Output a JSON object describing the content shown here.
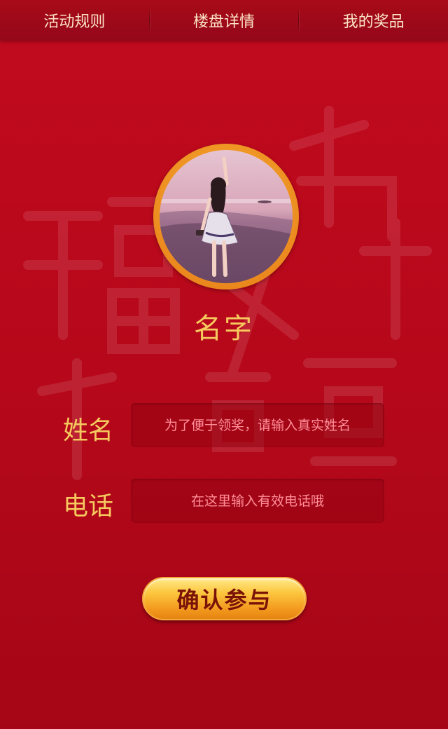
{
  "nav": {
    "items": [
      {
        "label": "活动规则"
      },
      {
        "label": "楼盘详情"
      },
      {
        "label": "我的奖品"
      }
    ]
  },
  "profile": {
    "name": "名字",
    "avatar_icon": "user-photo"
  },
  "form": {
    "name_label": "姓名",
    "name_placeholder": "为了便于领奖，请输入真实姓名",
    "phone_label": "电话",
    "phone_placeholder": "在这里输入有效电话哦"
  },
  "confirm": {
    "label": "确认参与"
  },
  "colors": {
    "background": "#c20a1e",
    "nav_text": "#fbe3c4",
    "gold_text": "#f6c95f",
    "button_text": "#7a1208"
  }
}
